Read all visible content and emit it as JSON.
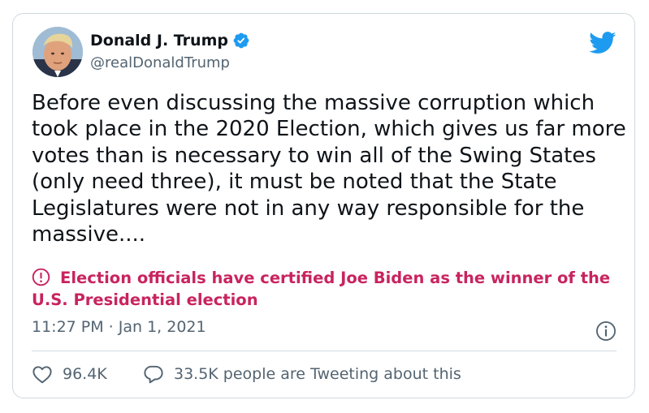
{
  "author": {
    "name": "Donald J. Trump",
    "handle": "@realDonaldTrump"
  },
  "tweet": {
    "text": "Before even discussing the massive corruption which took place in the 2020 Election, which gives us far more votes than is necessary to win all of the Swing States (only need three), it must be noted that the State Legislatures were not in any way responsible for the massive....",
    "notice": "Election officials have certified Joe Biden as the winner of the U.S. Presidential election",
    "timestamp": "11:27 PM · Jan 1, 2021"
  },
  "engagement": {
    "likes": "96.4K",
    "conversation": "33.5K people are Tweeting about this"
  },
  "colors": {
    "accent": "#1d9bf0",
    "notice": "#c8245f",
    "secondary_text": "#536471",
    "border": "#cfd9de"
  },
  "icons": [
    "verified-badge-icon",
    "twitter-bird-icon",
    "exclamation-circle-icon",
    "info-icon",
    "heart-icon",
    "speech-bubble-icon"
  ]
}
